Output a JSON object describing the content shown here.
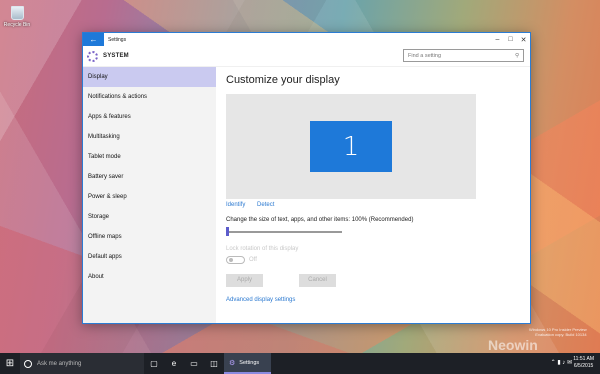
{
  "desktop": {
    "recycle_bin": "Recycle Bin"
  },
  "window": {
    "title": "Settings",
    "section": "SYSTEM",
    "search_placeholder": "Find a setting",
    "sidebar": [
      {
        "label": "Display"
      },
      {
        "label": "Notifications & actions"
      },
      {
        "label": "Apps & features"
      },
      {
        "label": "Multitasking"
      },
      {
        "label": "Tablet mode"
      },
      {
        "label": "Battery saver"
      },
      {
        "label": "Power & sleep"
      },
      {
        "label": "Storage"
      },
      {
        "label": "Offline maps"
      },
      {
        "label": "Default apps"
      },
      {
        "label": "About"
      }
    ],
    "content": {
      "heading": "Customize your display",
      "monitor_number": "1",
      "identify": "Identify",
      "detect": "Detect",
      "scale_label": "Change the size of text, apps, and other items: 100% (Recommended)",
      "scale_value": 0,
      "lock_label": "Lock rotation of this display",
      "toggle_state": "Off",
      "apply": "Apply",
      "cancel": "Cancel",
      "advanced": "Advanced display settings"
    }
  },
  "taskbar": {
    "search_text": "Ask me anything",
    "active_app": "Settings",
    "time": "11:51 AM",
    "date": "6/5/2015"
  },
  "watermark": {
    "line1": "Windows 10 Pro Insider Preview",
    "line2": "Evaluation copy. Build 10134",
    "brand": "Neowin"
  },
  "colors": {
    "accent": "#1e79d9",
    "selected_bg": "#cacaf0"
  }
}
